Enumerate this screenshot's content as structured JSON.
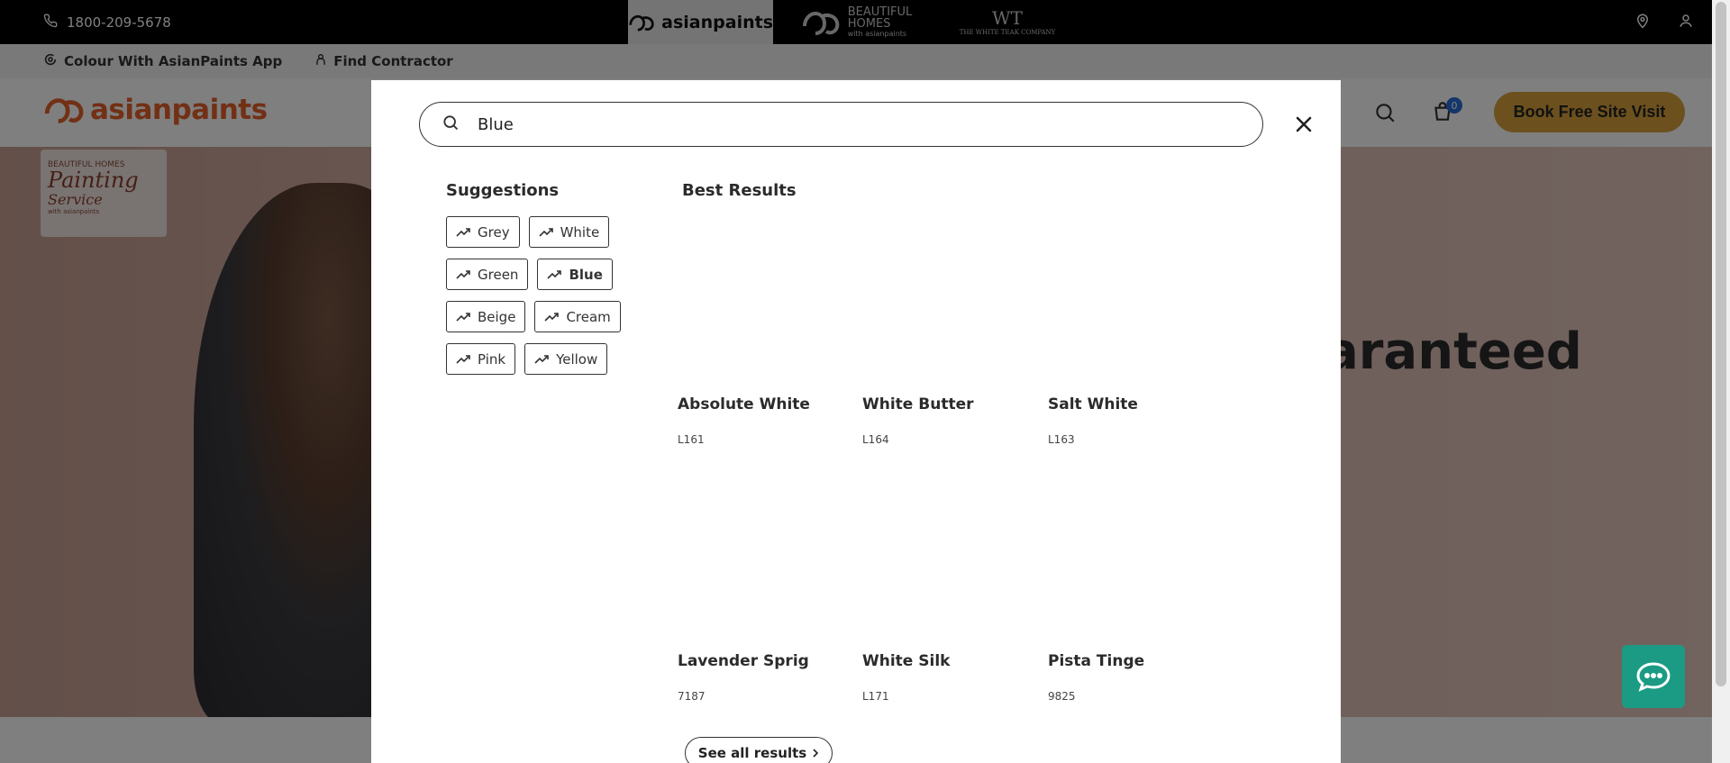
{
  "topbar": {
    "phone": "1800-209-5678",
    "brands": {
      "asianpaints": "asianpaints",
      "beautiful_homes_line1": "BEAUTIFUL",
      "beautiful_homes_line2": "HOMES",
      "beautiful_homes_sub": "with asianpaints",
      "white_teak_mark": "WT",
      "white_teak_name": "THE WHITE TEAK COMPANY"
    }
  },
  "subbar": {
    "app_link": "Colour With AsianPaints App",
    "contractor_link": "Find Contractor"
  },
  "header": {
    "logo_text": "asianpaints",
    "cart_count": "0",
    "book_button": "Book Free Site Visit"
  },
  "hero": {
    "badge_line1": "BEAUTIFUL HOMES",
    "badge_line2": "Painting",
    "badge_line3": "Service",
    "badge_line4": "with asianpaints",
    "headline_fragment": "aranteed"
  },
  "search": {
    "value": "Blue",
    "suggestions_title": "Suggestions",
    "best_results_title": "Best Results",
    "suggestions": [
      {
        "label": "Grey"
      },
      {
        "label": "White"
      },
      {
        "label": "Green"
      },
      {
        "label": "Blue"
      },
      {
        "label": "Beige"
      },
      {
        "label": "Cream"
      },
      {
        "label": "Pink"
      },
      {
        "label": "Yellow"
      }
    ],
    "results": [
      {
        "name": "Absolute White",
        "code": "L161"
      },
      {
        "name": "White Butter",
        "code": "L164"
      },
      {
        "name": "Salt White",
        "code": "L163"
      },
      {
        "name": "Lavender Sprig",
        "code": "7187"
      },
      {
        "name": "White Silk",
        "code": "L171"
      },
      {
        "name": "Pista Tinge",
        "code": "9825"
      }
    ],
    "see_all": "See all results"
  },
  "colors": {
    "accent_gold": "#d9a23c",
    "brand_orange": "#e4602a",
    "chat_green": "#1b9b83",
    "cart_badge_blue": "#2b6cd4"
  },
  "icons": [
    "phone-icon",
    "location-icon",
    "user-icon",
    "app-icon",
    "contractor-icon",
    "search-icon",
    "cart-icon",
    "close-icon",
    "trend-icon",
    "chevron-right-icon",
    "chat-icon"
  ]
}
